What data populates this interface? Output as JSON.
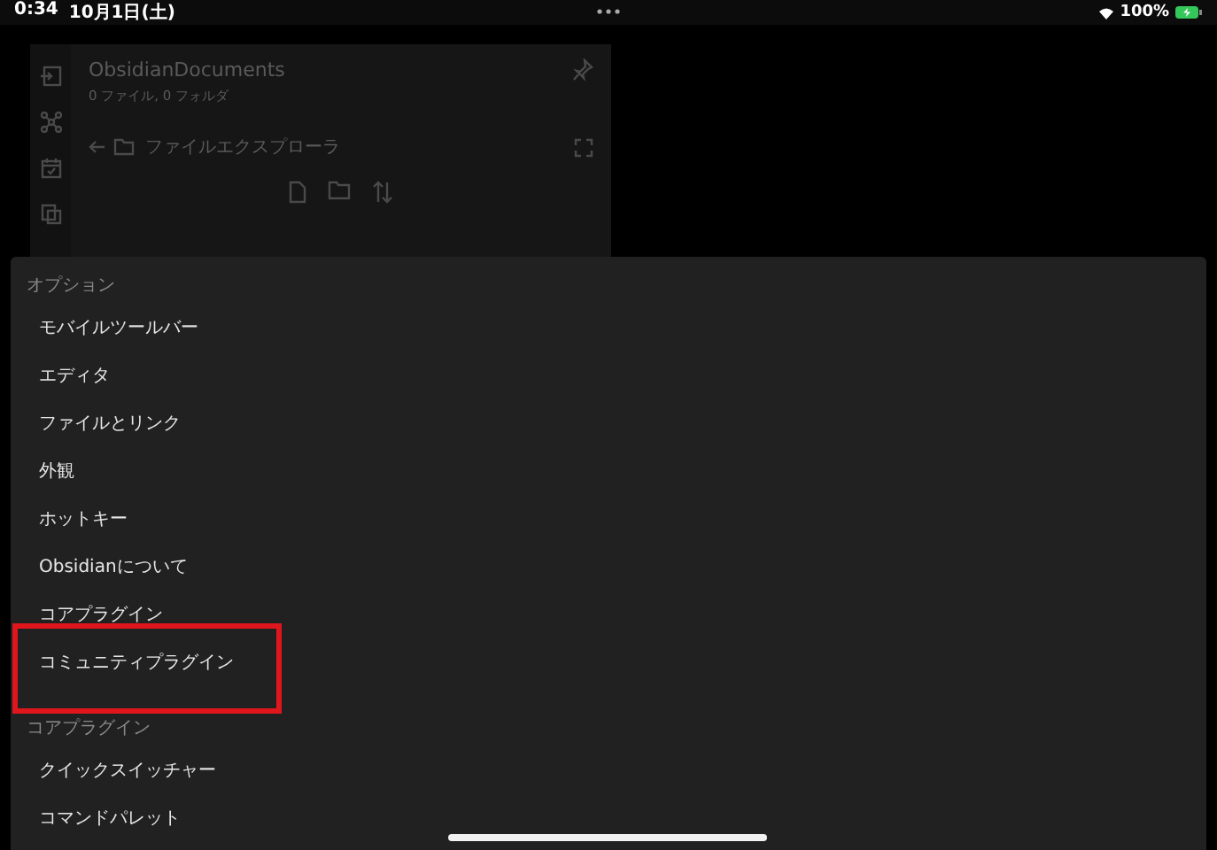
{
  "status_bar": {
    "time": "0:34",
    "date": "10月1日(土)",
    "battery": "100%"
  },
  "background_panel": {
    "vault_title": "ObsidianDocuments",
    "vault_summary": "0 ファイル, 0 フォルダ",
    "view_title": "ファイルエクスプローラ"
  },
  "settings": {
    "sections": [
      {
        "title": "オプション",
        "items": [
          {
            "label": "モバイルツールバー",
            "highlighted": false
          },
          {
            "label": "エディタ",
            "highlighted": false
          },
          {
            "label": "ファイルとリンク",
            "highlighted": false
          },
          {
            "label": "外観",
            "highlighted": false
          },
          {
            "label": "ホットキー",
            "highlighted": false
          },
          {
            "label": "Obsidianについて",
            "highlighted": false
          },
          {
            "label": "コアプラグイン",
            "highlighted": false
          },
          {
            "label": "コミュニティプラグイン",
            "highlighted": true
          }
        ]
      },
      {
        "title": "コアプラグイン",
        "items": [
          {
            "label": "クイックスイッチャー",
            "highlighted": false
          },
          {
            "label": "コマンドパレット",
            "highlighted": false
          }
        ]
      }
    ]
  }
}
